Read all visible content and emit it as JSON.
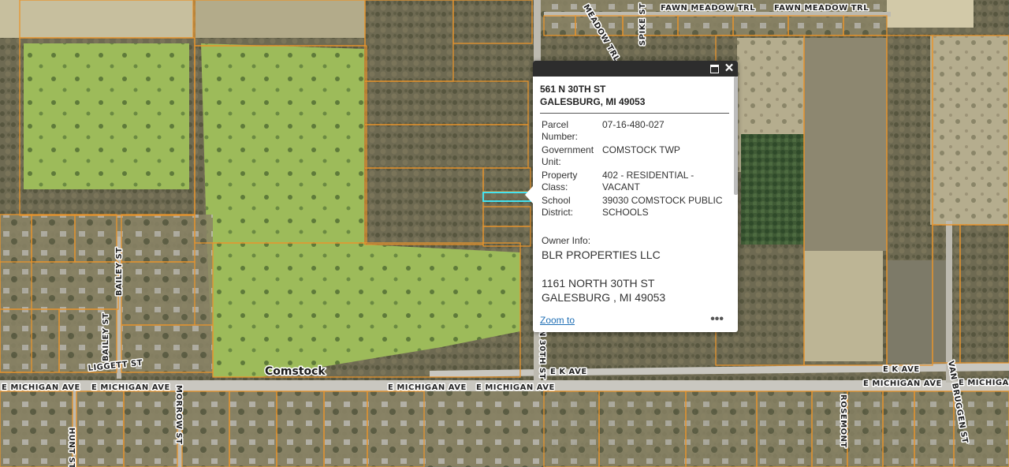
{
  "map": {
    "place_label": "Comstock",
    "streets": {
      "fawn_meadow_1": "FAWN MEADOW TRL",
      "fawn_meadow_2": "FAWN MEADOW TRL",
      "meadow_trl": "MEADOW TRL",
      "spike_st": "SPIKE ST",
      "bailey_st_1": "BAILEY ST",
      "bailey_st_2": "BAILEY ST",
      "liggett_st": "LIGGETT ST",
      "e_michigan_1": "E MICHIGAN AVE",
      "e_michigan_2": "E MICHIGAN AVE",
      "e_michigan_3": "E MICHIGAN AVE",
      "e_michigan_4": "E MICHIGAN AVE",
      "e_michigan_5": "E MICHIGAN AVE",
      "e_michigan_6": "E MICHIGAN",
      "morrow_st": "MORROW ST",
      "hunt_st": "HUNT ST",
      "n_30th_st": "N 30TH ST",
      "e_k_ave_1": "E K AVE",
      "e_k_ave_2": "E K AVE",
      "rosemont": "ROSEMONT",
      "van_bruggen": "VAN BRUGGEN ST"
    },
    "colors": {
      "parcel_line": "#e8942c",
      "selected_parcel": "#45e3f0"
    }
  },
  "popup": {
    "title_line1": "561 N 30TH ST",
    "title_line2": "GALESBURG, MI 49053",
    "attributes": [
      {
        "key": "Parcel Number:",
        "value": "07-16-480-027"
      },
      {
        "key": "Government Unit:",
        "value": "COMSTOCK TWP"
      },
      {
        "key": "Property Class:",
        "value": "402 - RESIDENTIAL - VACANT"
      },
      {
        "key": "School District:",
        "value": "39030 COMSTOCK PUBLIC SCHOOLS"
      }
    ],
    "owner_label": "Owner Info:",
    "owner_name": "BLR PROPERTIES LLC",
    "owner_address_line1": "1161 NORTH 30TH ST",
    "owner_address_line2": "GALESBURG , MI  49053",
    "zoom_link": "Zoom to",
    "more_label": "•••",
    "maximize_icon": "maximize-icon",
    "close_icon": "close-icon",
    "close_symbol": "✕"
  }
}
